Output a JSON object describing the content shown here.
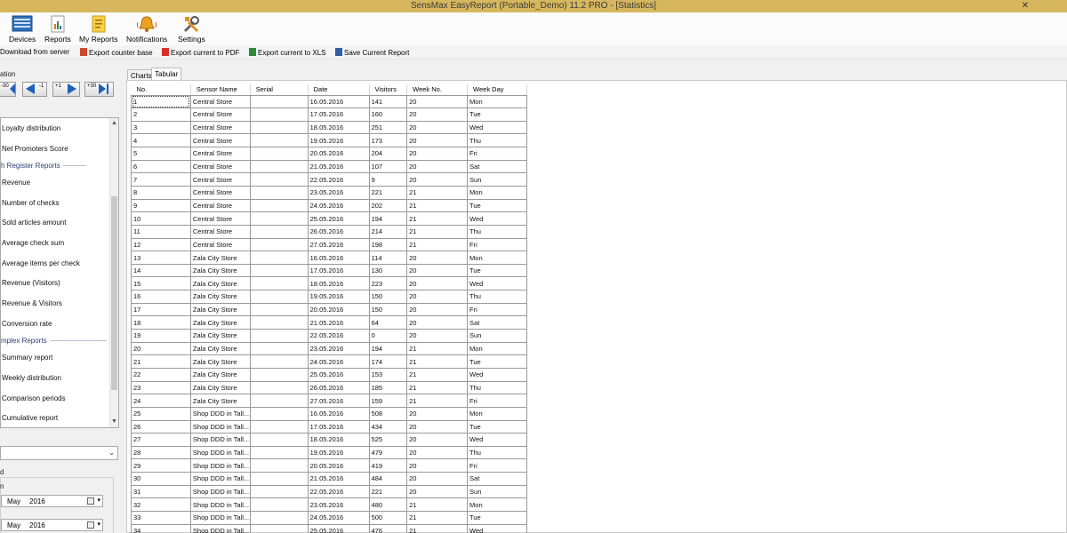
{
  "window": {
    "title": "SensMax EasyReport (Portable_Demo) 11.2 PRO - [Statistics]",
    "close_glyph": "✕"
  },
  "ribbon": {
    "buttons": [
      {
        "label": "Devices",
        "icon": "devices-icon"
      },
      {
        "label": "Reports",
        "icon": "reports-icon"
      },
      {
        "label": "My Reports",
        "icon": "my-reports-icon"
      },
      {
        "label": "Notifications",
        "icon": "notifications-icon"
      },
      {
        "label": "Settings",
        "icon": "settings-icon"
      }
    ]
  },
  "toolbar": {
    "download": "Download from server",
    "export_base": "Export counter base",
    "export_pdf": "Export current to PDF",
    "export_xls": "Export current to XLS",
    "save_report": "Save Current Report"
  },
  "left": {
    "navigation_label": "ation",
    "nav_buttons": [
      "-30",
      "-1",
      "+1",
      "+30"
    ],
    "report_list": [
      {
        "type": "item",
        "label": "Loyalty distribution"
      },
      {
        "type": "item",
        "label": "Net Promoters Score"
      },
      {
        "type": "header",
        "label": "h Register Reports"
      },
      {
        "type": "item",
        "label": "Revenue"
      },
      {
        "type": "item",
        "label": "Number of checks"
      },
      {
        "type": "item",
        "label": "Sold articles amount"
      },
      {
        "type": "item",
        "label": "Average check sum"
      },
      {
        "type": "item",
        "label": "Average items per check"
      },
      {
        "type": "item",
        "label": "Revenue (Visitors)"
      },
      {
        "type": "item",
        "label": "Revenue & Visitors"
      },
      {
        "type": "item",
        "label": "Conversion rate"
      },
      {
        "type": "header",
        "label": "mplex Reports"
      },
      {
        "type": "item",
        "label": "Summary report"
      },
      {
        "type": "item",
        "label": "Weekly distribution"
      },
      {
        "type": "item",
        "label": "Comparison periods"
      },
      {
        "type": "item",
        "label": "Cumulative report"
      }
    ],
    "period_label": "d",
    "from_label": "n",
    "date_from": {
      "month": "May",
      "year": "2016"
    },
    "date_to": {
      "month": "May",
      "year": "2016"
    }
  },
  "tabs": {
    "charts": "Charts",
    "tabular": "Tabular"
  },
  "table": {
    "columns": [
      "No.",
      "Sensor Name",
      "Serial",
      "Date",
      "Visitors",
      "Week No.",
      "Week Day"
    ],
    "rows": [
      [
        "1",
        "Central Store",
        "",
        "16.05.2016",
        "141",
        "20",
        "Mon"
      ],
      [
        "2",
        "Central Store",
        "",
        "17.05.2016",
        "160",
        "20",
        "Tue"
      ],
      [
        "3",
        "Central Store",
        "",
        "18.05.2016",
        "251",
        "20",
        "Wed"
      ],
      [
        "4",
        "Central Store",
        "",
        "19.05.2016",
        "173",
        "20",
        "Thu"
      ],
      [
        "5",
        "Central Store",
        "",
        "20.05.2016",
        "204",
        "20",
        "Fri"
      ],
      [
        "6",
        "Central Store",
        "",
        "21.05.2016",
        "107",
        "20",
        "Sat"
      ],
      [
        "7",
        "Central Store",
        "",
        "22.05.2016",
        "9",
        "20",
        "Sun"
      ],
      [
        "8",
        "Central Store",
        "",
        "23.05.2016",
        "221",
        "21",
        "Mon"
      ],
      [
        "9",
        "Central Store",
        "",
        "24.05.2016",
        "202",
        "21",
        "Tue"
      ],
      [
        "10",
        "Central Store",
        "",
        "25.05.2016",
        "194",
        "21",
        "Wed"
      ],
      [
        "11",
        "Central Store",
        "",
        "26.05.2016",
        "214",
        "21",
        "Thu"
      ],
      [
        "12",
        "Central Store",
        "",
        "27.05.2016",
        "198",
        "21",
        "Fri"
      ],
      [
        "13",
        "Zala City Store",
        "",
        "16.05.2016",
        "114",
        "20",
        "Mon"
      ],
      [
        "14",
        "Zala City Store",
        "",
        "17.05.2016",
        "130",
        "20",
        "Tue"
      ],
      [
        "15",
        "Zala City Store",
        "",
        "18.05.2016",
        "223",
        "20",
        "Wed"
      ],
      [
        "16",
        "Zala City Store",
        "",
        "19.05.2016",
        "150",
        "20",
        "Thu"
      ],
      [
        "17",
        "Zala City Store",
        "",
        "20.05.2016",
        "150",
        "20",
        "Fri"
      ],
      [
        "18",
        "Zala City Store",
        "",
        "21.05.2016",
        "64",
        "20",
        "Sat"
      ],
      [
        "19",
        "Zala City Store",
        "",
        "22.05.2016",
        "0",
        "20",
        "Sun"
      ],
      [
        "20",
        "Zala City Store",
        "",
        "23.05.2016",
        "194",
        "21",
        "Mon"
      ],
      [
        "21",
        "Zala City Store",
        "",
        "24.05.2016",
        "174",
        "21",
        "Tue"
      ],
      [
        "22",
        "Zala City Store",
        "",
        "25.05.2016",
        "153",
        "21",
        "Wed"
      ],
      [
        "23",
        "Zala City Store",
        "",
        "26.05.2016",
        "185",
        "21",
        "Thu"
      ],
      [
        "24",
        "Zala City Store",
        "",
        "27.05.2016",
        "159",
        "21",
        "Fri"
      ],
      [
        "25",
        "Shop DDD in Tall...",
        "",
        "16.05.2016",
        "508",
        "20",
        "Mon"
      ],
      [
        "26",
        "Shop DDD in Tall...",
        "",
        "17.05.2016",
        "434",
        "20",
        "Tue"
      ],
      [
        "27",
        "Shop DDD in Tall...",
        "",
        "18.05.2016",
        "525",
        "20",
        "Wed"
      ],
      [
        "28",
        "Shop DDD in Tall...",
        "",
        "19.05.2016",
        "479",
        "20",
        "Thu"
      ],
      [
        "29",
        "Shop DDD in Tall...",
        "",
        "20.05.2016",
        "419",
        "20",
        "Fri"
      ],
      [
        "30",
        "Shop DDD in Tall...",
        "",
        "21.05.2016",
        "484",
        "20",
        "Sat"
      ],
      [
        "31",
        "Shop DDD in Tall...",
        "",
        "22.05.2016",
        "221",
        "20",
        "Sun"
      ],
      [
        "32",
        "Shop DDD in Tall...",
        "",
        "23.05.2016",
        "480",
        "21",
        "Mon"
      ],
      [
        "33",
        "Shop DDD in Tall...",
        "",
        "24.05.2016",
        "500",
        "21",
        "Tue"
      ],
      [
        "34",
        "Shop DDD in Tall...",
        "",
        "25.05.2016",
        "476",
        "21",
        "Wed"
      ]
    ]
  },
  "colors": {
    "titlebar": "#d6b75e",
    "section_header": "#2c3e7a",
    "nav_arrow": "#1f5fb8"
  }
}
